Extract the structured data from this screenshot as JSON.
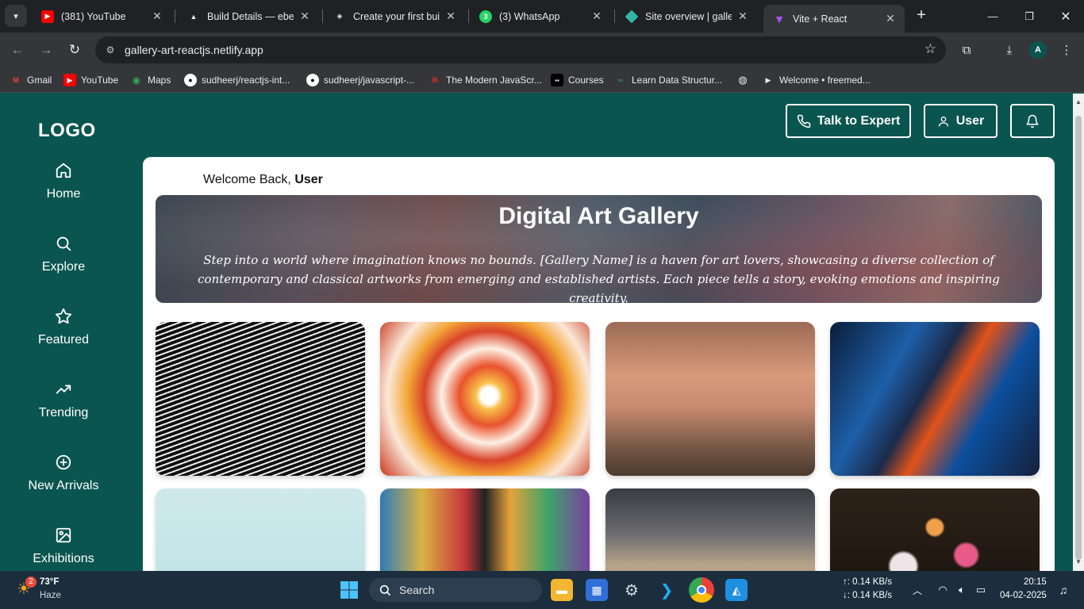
{
  "browser": {
    "tabs": [
      {
        "title": "(381) YouTube",
        "icon": "youtube-icon",
        "color": "#ff0000"
      },
      {
        "title": "Build Details — ebefd",
        "icon": "netlify-build-icon",
        "color": "#e8eaed"
      },
      {
        "title": "Create your first build",
        "icon": "build-icon",
        "color": "#e8eaed"
      },
      {
        "title": "(3) WhatsApp",
        "icon": "whatsapp-icon",
        "color": "#25d366"
      },
      {
        "title": "Site overview | gallery",
        "icon": "netlify-icon",
        "color": "#32b5a9"
      },
      {
        "title": "Vite + React",
        "icon": "vite-icon",
        "color": "#a855f7"
      }
    ],
    "url": "gallery-art-reactjs.netlify.app",
    "profile_initial": "A",
    "bookmarks": [
      {
        "label": "Gmail",
        "icon": "gmail-icon"
      },
      {
        "label": "YouTube",
        "icon": "youtube-icon"
      },
      {
        "label": "Maps",
        "icon": "maps-icon"
      },
      {
        "label": "sudheerj/reactjs-int...",
        "icon": "github-icon"
      },
      {
        "label": "sudheerj/javascript-...",
        "icon": "github-icon"
      },
      {
        "label": "The Modern JavaScr...",
        "icon": "js-info-icon"
      },
      {
        "label": "Courses",
        "icon": "courses-icon"
      },
      {
        "label": "Learn Data Structur...",
        "icon": "gfg-icon"
      },
      {
        "label": "",
        "icon": "globe-icon"
      },
      {
        "label": "Welcome • freemed...",
        "icon": "play-icon"
      }
    ]
  },
  "app": {
    "logo": "LOGO",
    "sidebar": [
      {
        "label": "Home",
        "icon": "home-icon"
      },
      {
        "label": "Explore",
        "icon": "search-icon"
      },
      {
        "label": "Featured",
        "icon": "star-icon"
      },
      {
        "label": "Trending",
        "icon": "trending-icon"
      },
      {
        "label": "New Arrivals",
        "icon": "plus-circle-icon"
      },
      {
        "label": "Exhibitions",
        "icon": "image-icon"
      }
    ],
    "header": {
      "talk_label": "Talk to Expert",
      "user_label": "User"
    },
    "welcome": {
      "prefix": "Welcome Back,",
      "name": "User"
    },
    "hero": {
      "title": "Digital Art Gallery",
      "text": "Step into a world where imagination knows no bounds. [Gallery Name] is a haven for art lovers, showcasing a diverse collection of contemporary and classical artworks from emerging and established artists. Each piece tells a story, evoking emotions and inspiring creativity."
    },
    "gallery": [
      {
        "name": "artwork-sketch-portrait"
      },
      {
        "name": "artwork-fluid-abstract"
      },
      {
        "name": "artwork-mural-face"
      },
      {
        "name": "artwork-blue-abstract"
      },
      {
        "name": "artwork-color-head"
      },
      {
        "name": "artwork-graffiti-eyes"
      },
      {
        "name": "artwork-classical-ceiling"
      },
      {
        "name": "artwork-flower-still-life"
      }
    ]
  },
  "taskbar": {
    "weather_temp": "73°F",
    "weather_desc": "Haze",
    "weather_badge": "2",
    "search_label": "Search",
    "net_up": "↑: 0.14 KB/s",
    "net_down": "↓: 0.14 KB/s",
    "time": "20:15",
    "date": "04-02-2025"
  },
  "colors": {
    "app_bg": "#0b5550",
    "panel_bg": "#ffffff"
  }
}
